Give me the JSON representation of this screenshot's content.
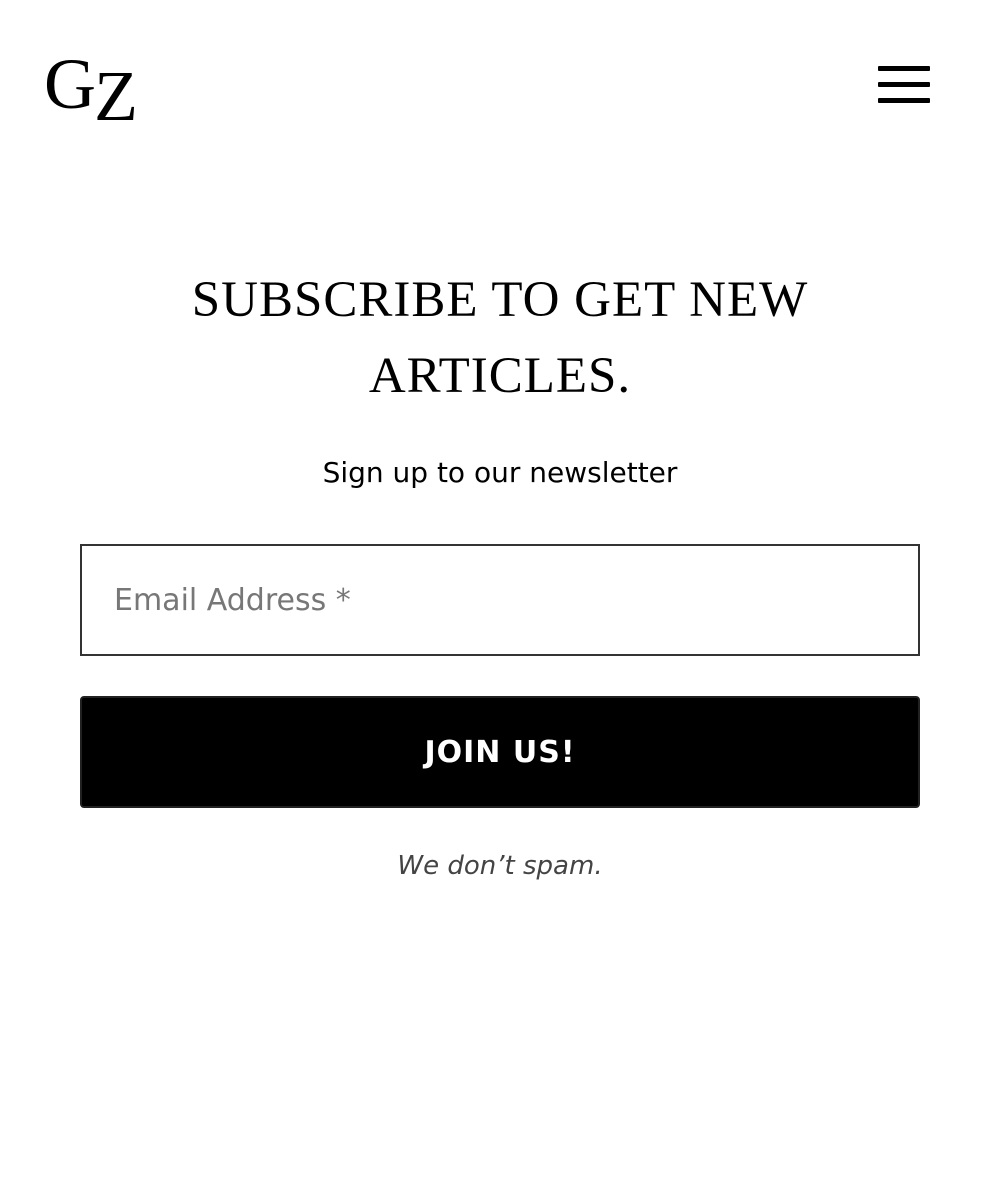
{
  "header": {
    "logo": {
      "first": "G",
      "second": "Z"
    },
    "menu_icon": "hamburger-menu-icon"
  },
  "newsletter": {
    "headline": "SUBSCRIBE TO GET NEW ARTICLES.",
    "subtitle": "Sign up to our newsletter",
    "email_placeholder": "Email Address *",
    "email_value": "",
    "submit_label": "JOIN US!",
    "disclaimer": "We don’t spam."
  },
  "colors": {
    "background": "#ffffff",
    "text": "#000000",
    "button_bg": "#000000",
    "button_text": "#ffffff",
    "placeholder": "#777777",
    "disclaimer": "#444444"
  }
}
